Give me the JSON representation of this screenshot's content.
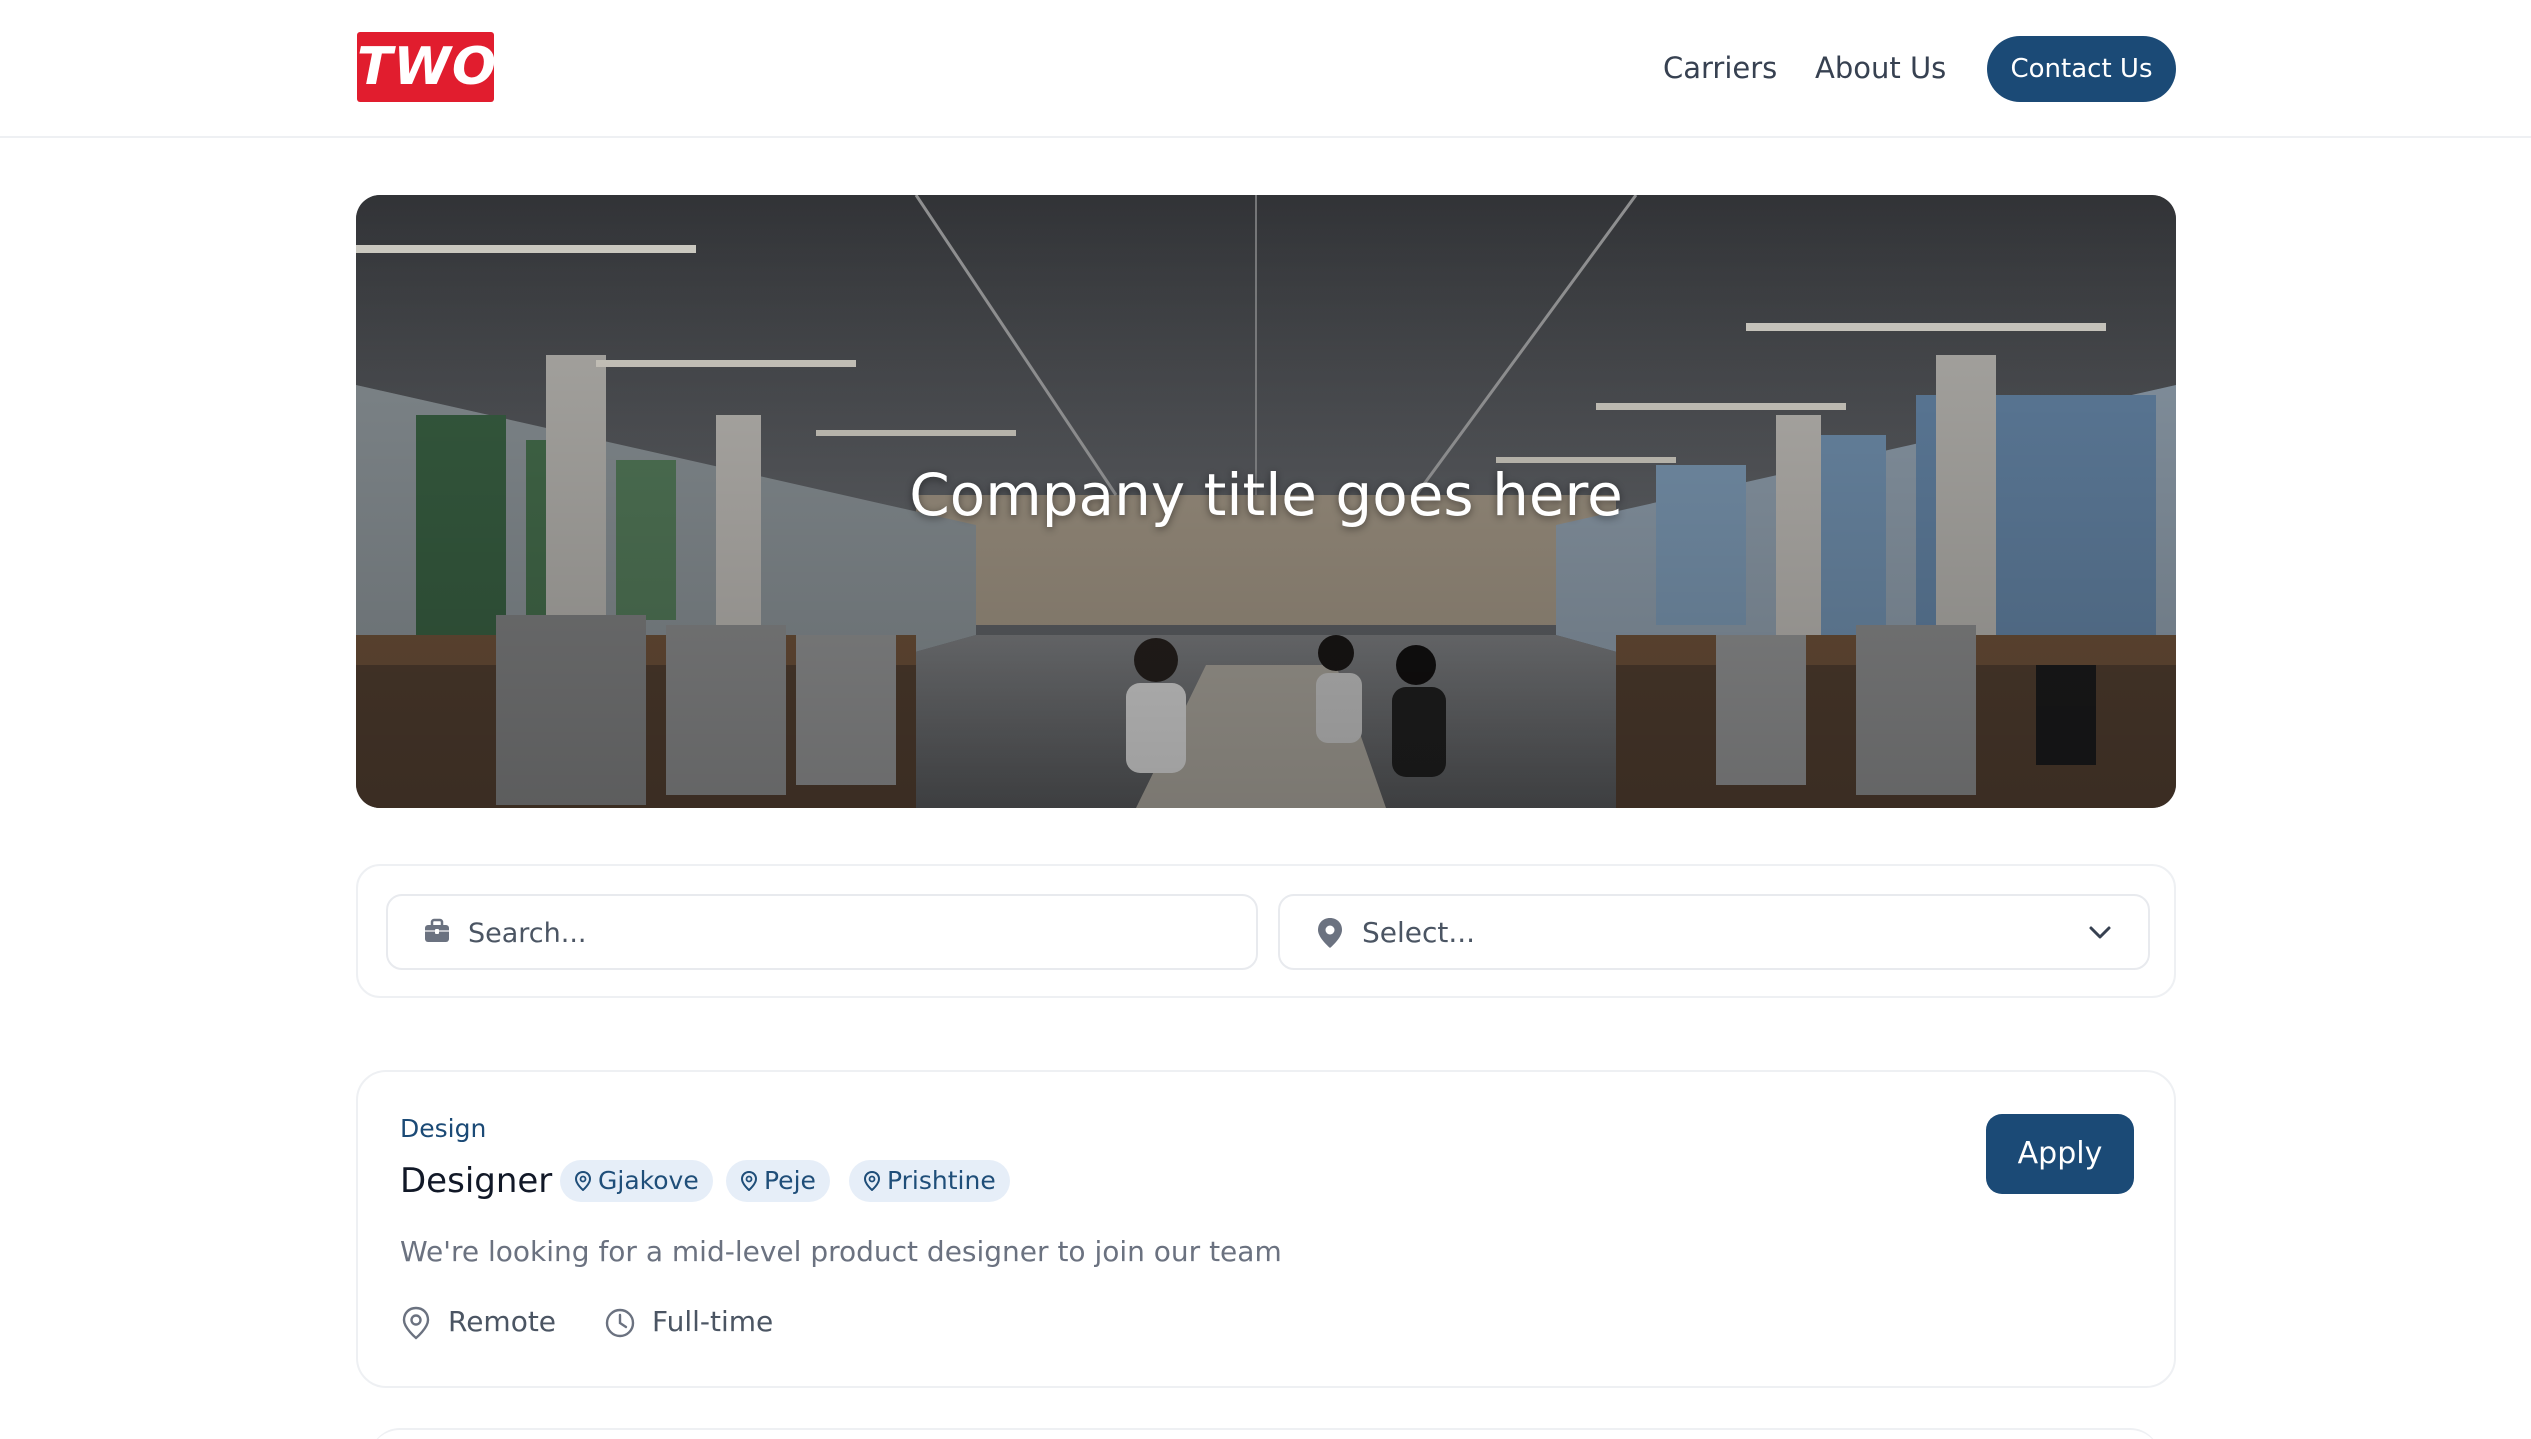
{
  "header": {
    "logo_text": "TWO",
    "nav": [
      "Carriers",
      "About Us"
    ],
    "contact_label": "Contact Us",
    "brand_color": "#e11d2e",
    "accent_color": "#1b4a76"
  },
  "hero": {
    "title": "Company title goes here",
    "image": "open-plan office photo"
  },
  "filters": {
    "search_placeholder": "Search...",
    "search_icon": "briefcase-icon",
    "location_select_value": "Select...",
    "location_icon": "map-pin-icon",
    "dropdown_icon": "chevron-down-icon"
  },
  "jobs": [
    {
      "category": "Design",
      "title": "Designer",
      "locations": [
        "Gjakove",
        "Peje",
        "Prishtine"
      ],
      "description": "We're looking for a mid-level product designer to join our team",
      "work_mode": "Remote",
      "employment_type": "Full-time",
      "apply_label": "Apply"
    }
  ]
}
